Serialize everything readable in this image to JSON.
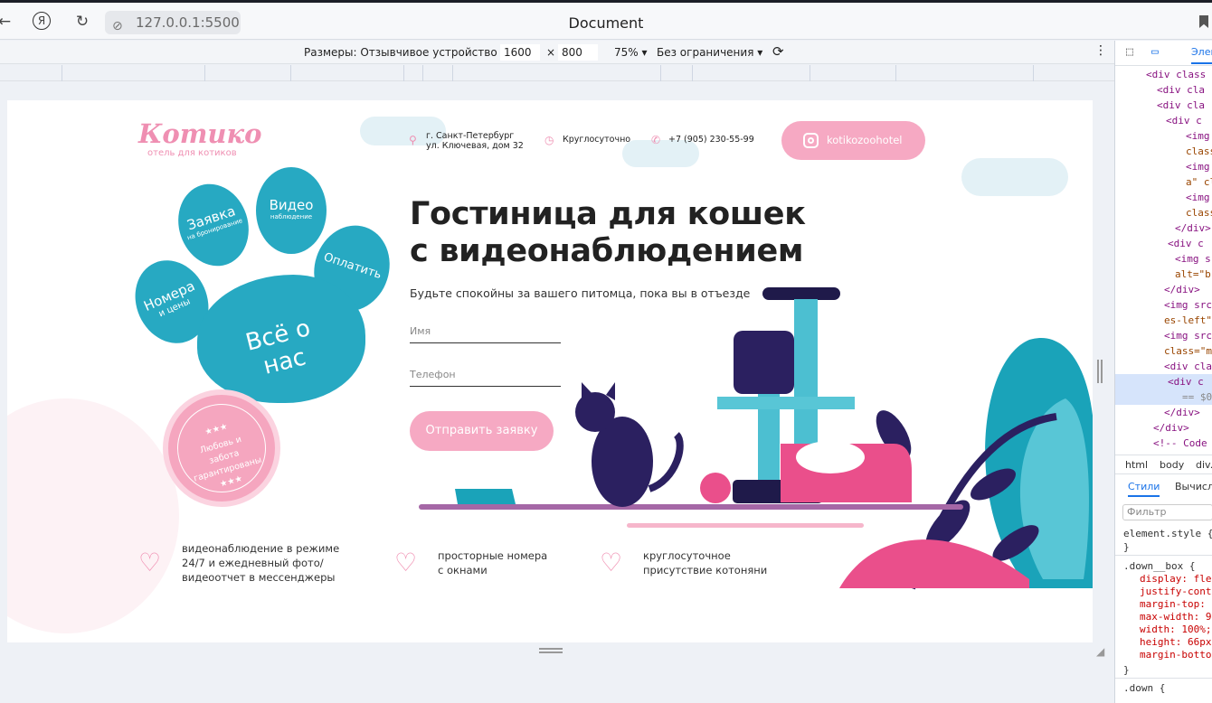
{
  "browser": {
    "url": "127.0.0.1:5500",
    "tab_title": "Document"
  },
  "device_toolbar": {
    "dimensions_label": "Размеры: Отзывчивое устройство",
    "width": "1600",
    "times": "×",
    "height": "800",
    "zoom": "75%",
    "throttle": "Без ограничения"
  },
  "site": {
    "logo": "Котико",
    "logo_sub": "отель для котиков",
    "address_line1": "г. Санкт-Петербург",
    "address_line2": "ул. Ключевая, дом 32",
    "hours": "Круглосуточно",
    "phone": "+7 (905) 230-55-99",
    "instagram": "kotikozoohotel",
    "paw": {
      "request_big": "Заявка",
      "request_small": "на бронирование",
      "video_big": "Видео",
      "video_small": "наблюдение",
      "pay": "Оплатить",
      "rooms_big": "Номера",
      "rooms_small": "и цены",
      "about": "Всё о нас"
    },
    "badge_stars": "★★★",
    "badge_text": "Любовь и забота гарантированы",
    "headline_1": "Гостиница для кошек",
    "headline_2": "с видеонаблюдением",
    "subline": "Будьте спокойны за вашего питомца, пока вы в отъезде",
    "name_placeholder": "Имя",
    "phone_placeholder": "Телефон",
    "submit": "Отправить заявку",
    "features": [
      {
        "line1": "видеонаблюдение в режиме",
        "line2": "24/7 и ежедневный фото/",
        "line3": "видеоотчет в мессенджеры"
      },
      {
        "line1": "просторные номера",
        "line2": "с окнами"
      },
      {
        "line1": "круглосуточное",
        "line2": "присутствие котоняни"
      }
    ]
  },
  "devtools": {
    "tab": "Элем",
    "crumbs": [
      "html",
      "body",
      "div."
    ],
    "styles_tab": "Стили",
    "computed_tab": "Вычисл",
    "filter": "Фильтр",
    "element_style": "element.style {",
    "close_brace": "}",
    "rule_selector": ".down__box {",
    "props": [
      "display: fle",
      "justify-conte",
      "margin-top:",
      "max-width: 9",
      "width: 100%;",
      "height: 66px",
      "margin-botto"
    ],
    "rule2": ".down {",
    "dom_lines": [
      "<div class",
      "<div cla",
      "<div cla",
      "<div c",
      "<img",
      "class",
      "<img",
      "a\" cl",
      "<img",
      "class",
      "</div>",
      "<div c",
      "<img s",
      "alt=\"b",
      "</div>",
      "<img src",
      "es-left\"",
      "<img src",
      "class=\"m",
      "<div cla",
      "<div c",
      "== $0",
      "</div>",
      "</div>",
      "<!-- Code"
    ]
  }
}
